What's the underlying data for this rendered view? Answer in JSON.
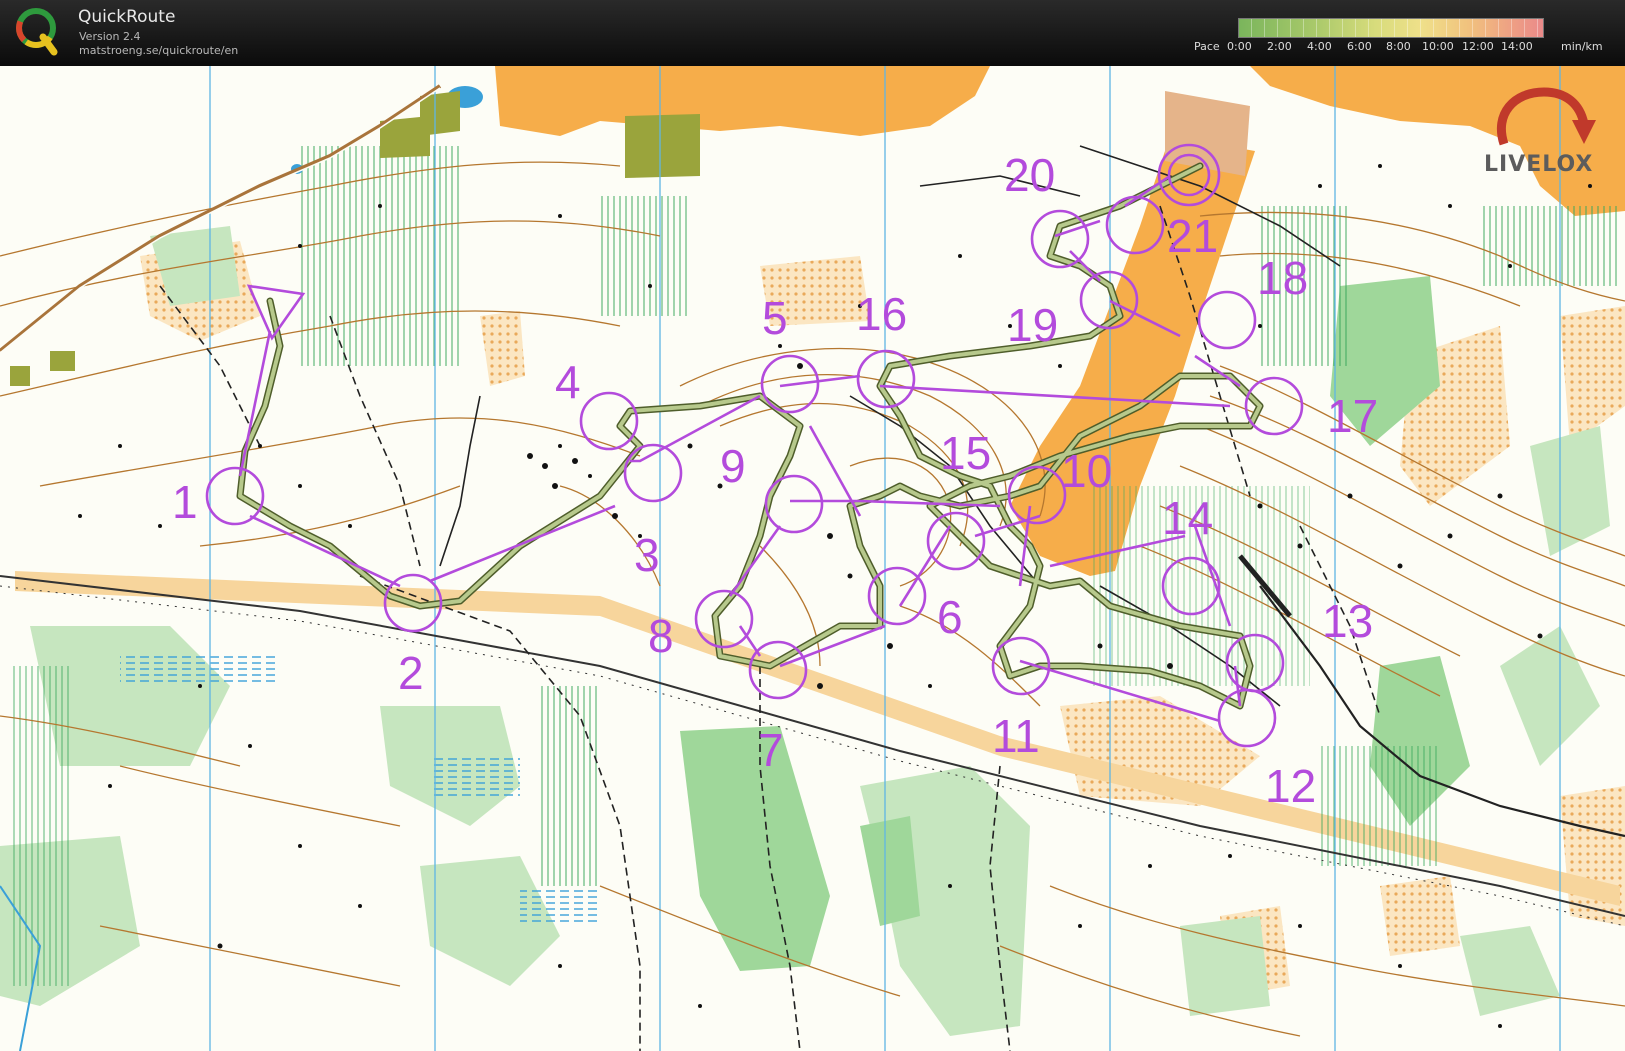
{
  "app": {
    "title": "QuickRoute",
    "version": "Version 2.4",
    "url": "matstroeng.se/quickroute/en"
  },
  "pace_legend": {
    "label": "Pace",
    "ticks": [
      "0:00",
      "2:00",
      "4:00",
      "6:00",
      "8:00",
      "10:00",
      "12:00",
      "14:00"
    ],
    "unit": "min/km",
    "gradient_colors": [
      "#7ab55c",
      "#a9c96a",
      "#d8dc7c",
      "#efe08a",
      "#f1c37e",
      "#ee9f84",
      "#ea8a8a"
    ]
  },
  "watermark": {
    "text": "LIVELOX",
    "arrow_color": "#c0392b"
  },
  "course": {
    "color": "#b34bdc",
    "start_symbol": "triangle",
    "finish_symbol": "double-circle",
    "controls": [
      "1",
      "2",
      "3",
      "4",
      "5",
      "6",
      "7",
      "8",
      "9",
      "10",
      "11",
      "12",
      "13",
      "14",
      "15",
      "16",
      "17",
      "18",
      "19",
      "20",
      "21"
    ]
  },
  "map_colors": {
    "background": "#fdfdf6",
    "open_land": "#f6ad4a",
    "rough_open": "#f7d59c",
    "vegetation": "#c6e6bf",
    "contour": "#b5772f",
    "water": "#3aa0d8",
    "route": "#9fb06a",
    "north_lines": "#5fb6e4",
    "village": "#9aa43c"
  }
}
